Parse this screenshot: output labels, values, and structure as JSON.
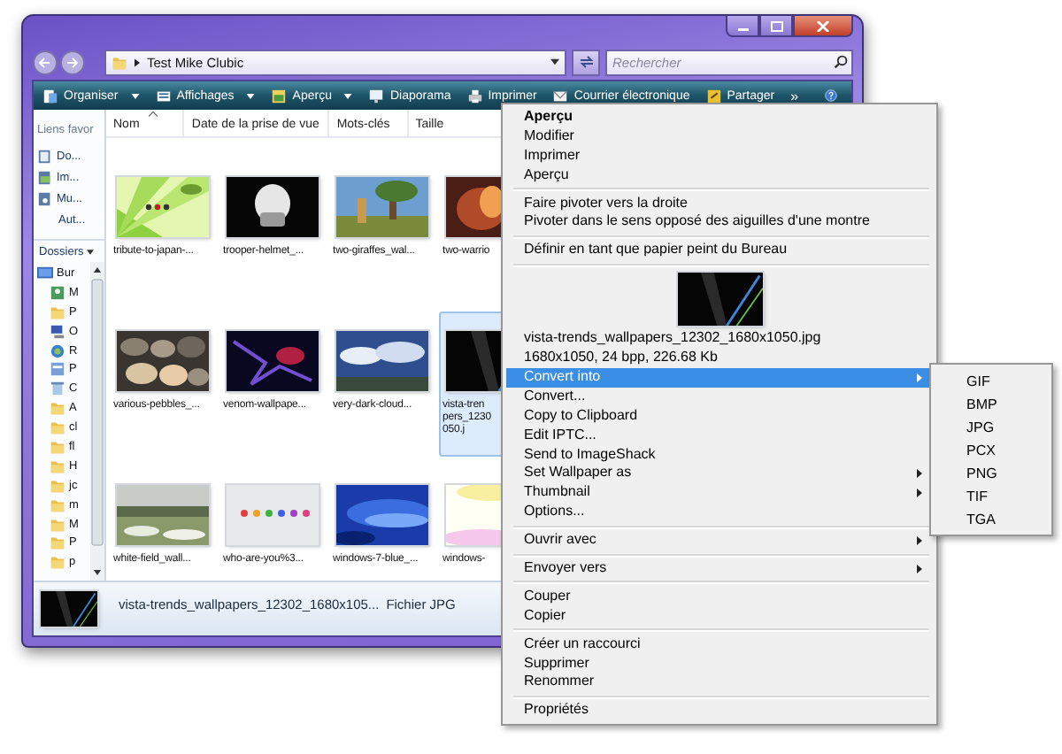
{
  "window": {
    "location": "Test Mike Clubic"
  },
  "search": {
    "placeholder": "Rechercher"
  },
  "toolbar": {
    "items": [
      {
        "label": "Organiser",
        "dropdown": true
      },
      {
        "label": "Affichages",
        "dropdown": true
      },
      {
        "label": "Aperçu",
        "dropdown": true
      },
      {
        "label": "Diaporama",
        "dropdown": false
      },
      {
        "label": "Imprimer",
        "dropdown": false
      },
      {
        "label": "Courrier électronique",
        "dropdown": false
      },
      {
        "label": "Partager",
        "dropdown": false
      }
    ],
    "overflow": "»"
  },
  "favorites": {
    "heading": "Liens favor",
    "items": [
      {
        "label": "Do...",
        "kind": "documents"
      },
      {
        "label": "Im...",
        "kind": "pictures"
      },
      {
        "label": "Mu...",
        "kind": "music"
      },
      {
        "label": "Aut...",
        "kind": "more"
      }
    ]
  },
  "folders": {
    "heading": "Dossiers",
    "tree": [
      {
        "label": "Bur",
        "kind": "desktop",
        "children": [
          {
            "label": "M",
            "kind": "user"
          },
          {
            "label": "P",
            "kind": "folder"
          },
          {
            "label": "O",
            "kind": "computer"
          },
          {
            "label": "R",
            "kind": "network"
          },
          {
            "label": "P",
            "kind": "panel"
          },
          {
            "label": "C",
            "kind": "bin"
          },
          {
            "label": "A",
            "kind": "folder"
          },
          {
            "label": "cl",
            "kind": "folder"
          },
          {
            "label": "fl",
            "kind": "folder"
          },
          {
            "label": "H",
            "kind": "folder"
          },
          {
            "label": "jc",
            "kind": "folder"
          },
          {
            "label": "m",
            "kind": "folder"
          },
          {
            "label": "M",
            "kind": "folder"
          },
          {
            "label": "P",
            "kind": "folder"
          },
          {
            "label": "p",
            "kind": "folder"
          }
        ]
      }
    ]
  },
  "columns": [
    "Nom",
    "Date de la prise de vue",
    "Mots-clés",
    "Taille"
  ],
  "files": [
    {
      "name": "tribute-to-japan-...",
      "selected": false
    },
    {
      "name": "trooper-helmet_...",
      "selected": false
    },
    {
      "name": "two-giraffes_wal...",
      "selected": false
    },
    {
      "name": "two-warrio",
      "selected": false
    },
    {
      "name": "various-pebbles_...",
      "selected": false
    },
    {
      "name": "venom-wallpape...",
      "selected": false
    },
    {
      "name": "very-dark-cloud...",
      "selected": false
    },
    {
      "name": "vista-tren\npers_1230\n050.j",
      "selected": true
    },
    {
      "name": "white-field_wall...",
      "selected": false
    },
    {
      "name": "who-are-you%3...",
      "selected": false
    },
    {
      "name": "windows-7-blue_...",
      "selected": false
    },
    {
      "name": "windows-",
      "selected": false
    }
  ],
  "status_bar": {
    "name": "vista-trends_wallpapers_12302_1680x105...",
    "type": "Fichier JPG"
  },
  "context_menu": {
    "sections": [
      {
        "items": [
          {
            "kind": "command",
            "label": "Aperçu",
            "default": true,
            "has_submenu": false,
            "selected": false
          },
          {
            "kind": "command",
            "label": "Modifier",
            "default": false,
            "has_submenu": false,
            "selected": false
          },
          {
            "kind": "command",
            "label": "Imprimer",
            "default": false,
            "has_submenu": false,
            "selected": false
          },
          {
            "kind": "command",
            "label": "Aperçu",
            "default": false,
            "has_submenu": false,
            "selected": false
          }
        ]
      },
      {
        "items": [
          {
            "kind": "command",
            "label": "Faire pivoter vers la droite",
            "default": false,
            "has_submenu": false,
            "selected": false
          },
          {
            "kind": "command",
            "label": "Pivoter dans le sens opposé des aiguilles d'une montre",
            "default": false,
            "has_submenu": false,
            "selected": false
          }
        ]
      },
      {
        "items": [
          {
            "kind": "command",
            "label": "Définir en tant que papier peint du Bureau",
            "default": false,
            "has_submenu": false,
            "selected": false
          }
        ]
      },
      {
        "items": [
          {
            "kind": "picture"
          },
          {
            "kind": "info",
            "label": "vista-trends_wallpapers_12302_1680x1050.jpg"
          },
          {
            "kind": "info",
            "label": "1680x1050, 24 bpp, 226.68 Kb"
          },
          {
            "kind": "command",
            "label": "Convert into",
            "default": false,
            "has_submenu": true,
            "selected": true
          },
          {
            "kind": "command",
            "label": "Convert...",
            "default": false,
            "has_submenu": false,
            "selected": false
          },
          {
            "kind": "command",
            "label": "Copy to Clipboard",
            "default": false,
            "has_submenu": false,
            "selected": false
          },
          {
            "kind": "command",
            "label": "Edit IPTC...",
            "default": false,
            "has_submenu": false,
            "selected": false
          },
          {
            "kind": "command",
            "label": "Send to ImageShack",
            "default": false,
            "has_submenu": false,
            "selected": false
          },
          {
            "kind": "command",
            "label": "Set Wallpaper as",
            "default": false,
            "has_submenu": true,
            "selected": false
          },
          {
            "kind": "command",
            "label": "Thumbnail",
            "default": false,
            "has_submenu": true,
            "selected": false
          },
          {
            "kind": "command",
            "label": "Options...",
            "default": false,
            "has_submenu": false,
            "selected": false
          }
        ]
      },
      {
        "items": [
          {
            "kind": "command",
            "label": "Ouvrir avec",
            "default": false,
            "has_submenu": true,
            "selected": false
          }
        ]
      },
      {
        "items": [
          {
            "kind": "command",
            "label": "Envoyer vers",
            "default": false,
            "has_submenu": true,
            "selected": false
          }
        ]
      },
      {
        "items": [
          {
            "kind": "command",
            "label": "Couper",
            "default": false,
            "has_submenu": false,
            "selected": false
          },
          {
            "kind": "command",
            "label": "Copier",
            "default": false,
            "has_submenu": false,
            "selected": false
          }
        ]
      },
      {
        "items": [
          {
            "kind": "command",
            "label": "Créer un raccourci",
            "default": false,
            "has_submenu": false,
            "selected": false
          },
          {
            "kind": "command",
            "label": "Supprimer",
            "default": false,
            "has_submenu": false,
            "selected": false
          },
          {
            "kind": "command",
            "label": "Renommer",
            "default": false,
            "has_submenu": false,
            "selected": false
          }
        ]
      },
      {
        "items": [
          {
            "kind": "command",
            "label": "Propriétés",
            "default": false,
            "has_submenu": false,
            "selected": false
          }
        ]
      }
    ]
  },
  "submenu": {
    "items": [
      "GIF",
      "BMP",
      "JPG",
      "PCX",
      "PNG",
      "TIF",
      "TGA"
    ]
  }
}
